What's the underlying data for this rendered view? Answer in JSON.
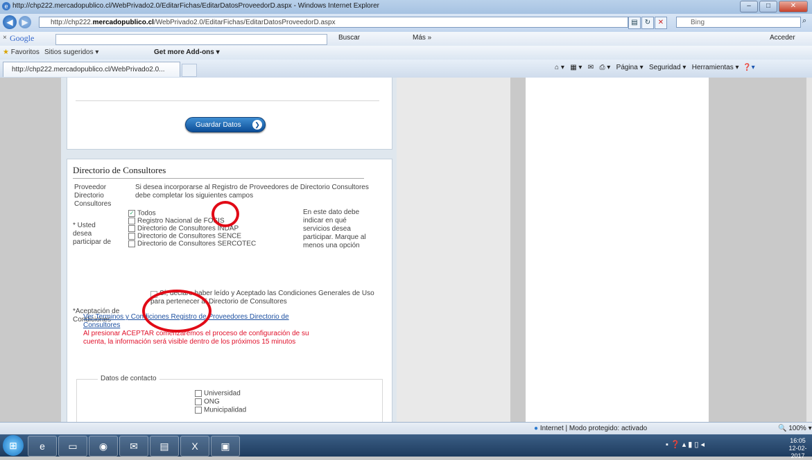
{
  "window": {
    "title": "http://chp222.mercadopublico.cl/WebPrivado2.0/EditarFichas/EditarDatosProveedorD.aspx - Windows Internet Explorer"
  },
  "address_bar": {
    "url_prefix": "http://chp222.",
    "url_domain": "mercadopublico.cl",
    "url_rest": "/WebPrivado2.0/EditarFichas/EditarDatosProveedorD.aspx",
    "search_engine": "Bing"
  },
  "google_toolbar": {
    "logo": "Google",
    "search_label": "Buscar",
    "more_label": "Más »",
    "signin_label": "Acceder"
  },
  "favorites_bar": {
    "favorites_label": "Favoritos",
    "suggested_sites": "Sitios sugeridos",
    "addons": "Get more Add-ons"
  },
  "tab": {
    "label": "http://chp222.mercadopublico.cl/WebPrivado2.0..."
  },
  "command_bar": {
    "pagina": "Página",
    "seguridad": "Seguridad",
    "herramientas": "Herramientas"
  },
  "page": {
    "save_button": "Guardar Datos",
    "section_title": "Directorio de Consultores",
    "provider_label": "Proveedor Directorio Consultores",
    "provider_desc": "Si desea incorporarse al Registro de Proveedores de Directorio Consultores debe completar los siguientes campos",
    "participate_label": "* Usted desea participar de",
    "participate_options": [
      {
        "label": "Todos",
        "checked": true
      },
      {
        "label": "Registro Nacional de FOSIS",
        "checked": false
      },
      {
        "label": "Directorio de Consultores INDAP",
        "checked": false
      },
      {
        "label": "Directorio de Consultores SENCE",
        "checked": false
      },
      {
        "label": "Directorio de Consultores SERCOTEC",
        "checked": false
      }
    ],
    "participate_hint": "En este dato debe indicar en qué servicios desea participar. Marque al menos una opción",
    "acceptance_label": "*Aceptación de Condiciones",
    "acceptance_checkbox": "Sí, declaro haber leído y Aceptado las Condiciones Generales de Uso para pertenecer al Directorio de Consultores",
    "terms_link": "Ver Terminos y Condiciones Registro de Proveedores Directorio de Consultores",
    "warning": "Al presionar ACEPTAR comenzaremos el proceso de configuración de su cuenta, la información será visible dentro de los próximos 15 minutos",
    "contact_legend": "Datos de contacto",
    "contact_options": [
      "Universidad",
      "ONG",
      "Municipalidad"
    ]
  },
  "status_bar": {
    "zone": "Internet | Modo protegido: activado",
    "zoom": "100%"
  },
  "taskbar": {
    "time": "16:05",
    "date": "12-02-2017"
  },
  "colors": {
    "annotation": "#e10a16",
    "link": "#1c4fa0",
    "warning": "#e0102a",
    "button": "#0d4e97"
  }
}
